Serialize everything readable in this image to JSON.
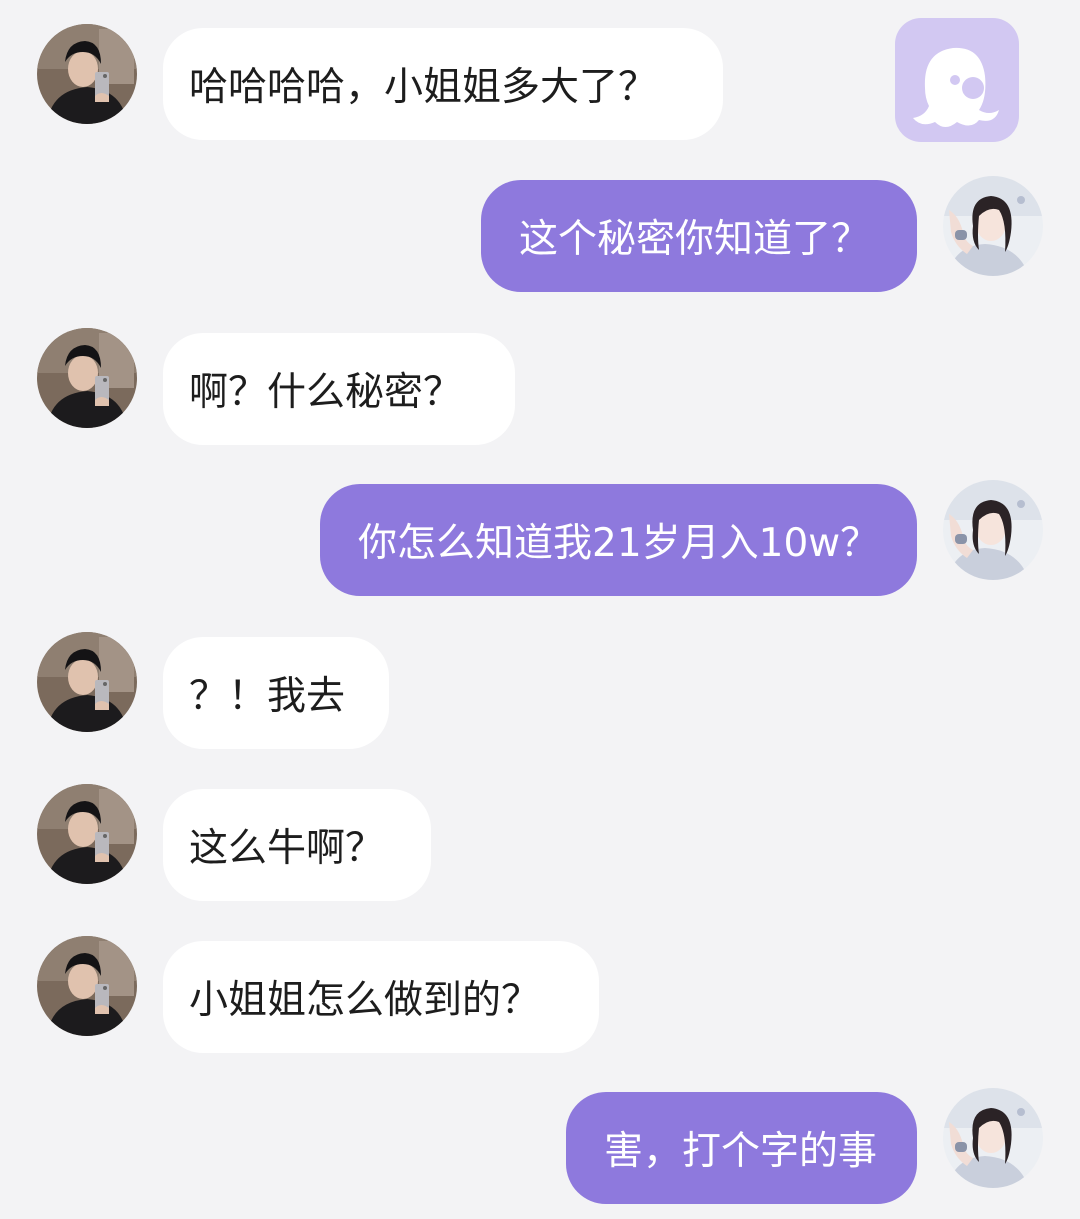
{
  "app": {
    "icon": "octopus-app-icon",
    "colors": {
      "background": "#f3f3f5",
      "incoming_bubble": "#ffffff",
      "outgoing_bubble": "#8e79dd",
      "app_icon": "#d2c8f2"
    }
  },
  "messages": [
    {
      "sender": "other",
      "text": "哈哈哈哈，小姐姐多大了？"
    },
    {
      "sender": "self",
      "text": "这个秘密你知道了？"
    },
    {
      "sender": "other",
      "text": "啊？什么秘密？"
    },
    {
      "sender": "self",
      "text": "你怎么知道我21岁月入10w？"
    },
    {
      "sender": "other",
      "text": "？！我去"
    },
    {
      "sender": "other",
      "text": "这么牛啊？"
    },
    {
      "sender": "other",
      "text": "小姐姐怎么做到的？"
    },
    {
      "sender": "self",
      "text": "害，打个字的事"
    }
  ]
}
